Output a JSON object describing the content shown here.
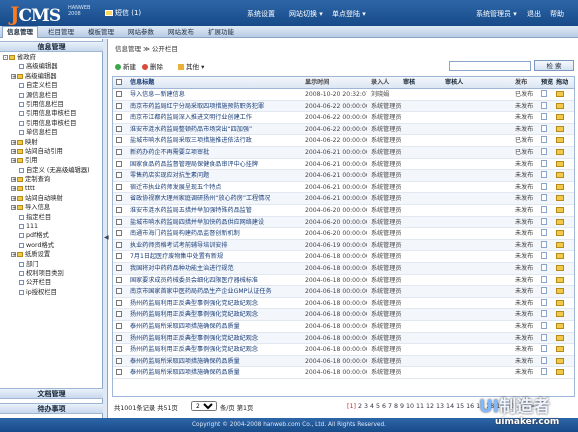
{
  "app": {
    "logo_j": "J",
    "logo_rest": "CMS",
    "logo_sub1": "HANWEB",
    "logo_sub2": "2008"
  },
  "header": {
    "messages": "短信 (1)",
    "links": [
      "系统设置",
      "网站切换 ▾",
      "单点登陆 ▾",
      "系统管理员 ▾",
      "退出",
      "帮助"
    ]
  },
  "nav": {
    "tabs": [
      "信息管理",
      "栏目管理",
      "模板管理",
      "网站参数",
      "网站发布",
      "扩展功能"
    ]
  },
  "sidebar": {
    "title": "信息管理",
    "tree": [
      {
        "label": "省政府",
        "d": 0,
        "x": "-",
        "t": "f"
      },
      {
        "label": "高级编辑器",
        "d": 1,
        "x": "",
        "t": "p"
      },
      {
        "label": "高级编辑器",
        "d": 1,
        "x": "+",
        "t": "f"
      },
      {
        "label": "自定义栏目",
        "d": 1,
        "x": "",
        "t": "p"
      },
      {
        "label": "源信息栏目",
        "d": 1,
        "x": "",
        "t": "p"
      },
      {
        "label": "引用信息栏目",
        "d": 1,
        "x": "",
        "t": "p"
      },
      {
        "label": "引用信息审核栏目",
        "d": 1,
        "x": "",
        "t": "p"
      },
      {
        "label": "引用信息审核栏目",
        "d": 1,
        "x": "",
        "t": "p"
      },
      {
        "label": "单信息栏目",
        "d": 1,
        "x": "",
        "t": "p"
      },
      {
        "label": "映射",
        "d": 1,
        "x": "+",
        "t": "f"
      },
      {
        "label": "站间自动引用",
        "d": 1,
        "x": "+",
        "t": "f"
      },
      {
        "label": "引用",
        "d": 1,
        "x": "+",
        "t": "f"
      },
      {
        "label": "自定义 (无高级编辑器)",
        "d": 1,
        "x": "",
        "t": "p"
      },
      {
        "label": "定制查询",
        "d": 1,
        "x": "+",
        "t": "f"
      },
      {
        "label": "tttt",
        "d": 1,
        "x": "+",
        "t": "f"
      },
      {
        "label": "站间自动映射",
        "d": 1,
        "x": "+",
        "t": "f"
      },
      {
        "label": "导入信息",
        "d": 1,
        "x": "+",
        "t": "f"
      },
      {
        "label": "指定栏目",
        "d": 1,
        "x": "",
        "t": "p"
      },
      {
        "label": "111",
        "d": 1,
        "x": "",
        "t": "p"
      },
      {
        "label": "pdf格式",
        "d": 1,
        "x": "",
        "t": "p"
      },
      {
        "label": "word格式",
        "d": 1,
        "x": "",
        "t": "p"
      },
      {
        "label": "纸质设置",
        "d": 1,
        "x": "+",
        "t": "f"
      },
      {
        "label": "部门",
        "d": 1,
        "x": "",
        "t": "p"
      },
      {
        "label": "权利项目类别",
        "d": 1,
        "x": "",
        "t": "p"
      },
      {
        "label": "公开栏目",
        "d": 1,
        "x": "",
        "t": "p"
      },
      {
        "label": "ip授权栏目",
        "d": 1,
        "x": "",
        "t": "p"
      }
    ],
    "section_docs": "文档管理",
    "section_tasks": "待办事项"
  },
  "main": {
    "breadcrumb": "信息管理 ≫ 公开栏目",
    "toolbar": {
      "add": "新建",
      "delete": "删除",
      "other": "其他 ▾",
      "search": "检 索"
    },
    "table": {
      "headers": [
        "信息标题",
        "显示时间",
        "录入人",
        "审核",
        "审核人",
        "发布",
        "预览",
        "拖动"
      ],
      "rows": [
        {
          "title": "导入信息—新建信息",
          "date": "2008-10-20 20:32:07",
          "user": "刘晓娟",
          "pub": "已发布"
        },
        {
          "title": "南京市药监局红宁分局采取四项措施预防职务犯罪",
          "date": "2004-06-22 00:00:00",
          "user": "系统管理员",
          "pub": "未发布"
        },
        {
          "title": "南京市江都药监局深入推进文明行业创建工作",
          "date": "2004-06-22 00:00:00",
          "user": "系统管理员",
          "pub": "未发布"
        },
        {
          "title": "淮安市涟水药监局整顿药品市场突出“四加强”",
          "date": "2004-06-22 00:00:00",
          "user": "系统管理员",
          "pub": "未发布"
        },
        {
          "title": "盐城市响水药监局采取三项措施推进依法行政",
          "date": "2004-06-22 00:00:00",
          "user": "系统管理员",
          "pub": "已发布"
        },
        {
          "title": "新药办药企不再需要立项审批",
          "date": "2004-06-21 00:00:00",
          "user": "系统管理员",
          "pub": "已发布"
        },
        {
          "title": "国家食品药品监督管理局保健食品审评中心挂牌",
          "date": "2004-06-21 00:00:00",
          "user": "系统管理员",
          "pub": "未发布"
        },
        {
          "title": "零售药店实现应对抗生素问题",
          "date": "2004-06-21 00:00:00",
          "user": "系统管理员",
          "pub": "未发布"
        },
        {
          "title": "宿迁市执业药师发展呈现五个特点",
          "date": "2004-06-21 00:00:00",
          "user": "系统管理员",
          "pub": "未发布"
        },
        {
          "title": "省政协视察大理州家庭调研扬州“放心药房”工程情况",
          "date": "2004-06-21 00:00:00",
          "user": "系统管理员",
          "pub": "未发布"
        },
        {
          "title": "淮安市涟水药监局五措并举加强特殊药品监管",
          "date": "2004-06-20 00:00:00",
          "user": "系统管理员",
          "pub": "未发布"
        },
        {
          "title": "盐城市响水药监局四措并举加快药品供应网络建设",
          "date": "2004-06-20 00:00:00",
          "user": "系统管理员",
          "pub": "未发布"
        },
        {
          "title": "南通市海门药监局构建药品监督创新机制",
          "date": "2004-06-20 00:00:00",
          "user": "系统管理员",
          "pub": "未发布"
        },
        {
          "title": "执业药师资格考试考前辅导培训安排",
          "date": "2004-06-19 00:00:00",
          "user": "系统管理员",
          "pub": "未发布"
        },
        {
          "title": "7月1日起医疗废物集中处置有新规",
          "date": "2004-06-18 00:00:00",
          "user": "系统管理员",
          "pub": "未发布"
        },
        {
          "title": "我国将对中药药品种功能主治进行规范",
          "date": "2004-06-18 00:00:00",
          "user": "系统管理员",
          "pub": "未发布"
        },
        {
          "title": "国家要求成员药械委员会细化四限医疗器械标准",
          "date": "2004-06-18 00:00:00",
          "user": "系统管理员",
          "pub": "未发布"
        },
        {
          "title": "南京市国家首家中医药局药品生产企业GMP认证任务",
          "date": "2004-06-18 00:00:00",
          "user": "系统管理员",
          "pub": "未发布"
        },
        {
          "title": "扬州药监局利用正反典型事例强化党纪政纪观念",
          "date": "2004-06-18 00:00:00",
          "user": "系统管理员",
          "pub": "未发布"
        },
        {
          "title": "扬州药监局利用正反典型事例强化党纪政纪观念",
          "date": "2004-06-18 00:00:00",
          "user": "系统管理员",
          "pub": "未发布"
        },
        {
          "title": "泰州药监局所采取四项措施确保药品质量",
          "date": "2004-06-18 00:00:00",
          "user": "系统管理员",
          "pub": "未发布"
        },
        {
          "title": "扬州药监局利用正反典型事例强化党纪政纪观念",
          "date": "2004-06-18 00:00:00",
          "user": "系统管理员",
          "pub": "未发布"
        },
        {
          "title": "扬州药监局利用正反典型事例强化党纪政纪观念",
          "date": "2004-06-18 00:00:00",
          "user": "系统管理员",
          "pub": "未发布"
        },
        {
          "title": "泰州药监局所采取四项措施确保药品质量",
          "date": "2004-06-18 00:00:00",
          "user": "系统管理员",
          "pub": "未发布"
        },
        {
          "title": "泰州药监局所采取四项措施确保药品质量",
          "date": "2004-06-18 00:00:00",
          "user": "系统管理员",
          "pub": "未发布"
        }
      ]
    },
    "pager": {
      "total": "共1001条记录  共51页",
      "page_size": "20",
      "per_page_text": "条/页  第1页",
      "current_page": "[1]",
      "pages": "2 3 4 5 6 7 8 9 10 11 12 13 14 15 16 17 18 19 20 ...  >>"
    }
  },
  "footer": {
    "text": "Copyright © 2004-2008 hanweb.com Co., Ltd. All Rights Reserved."
  },
  "watermark": {
    "ui": "UI",
    "line1": "制造者",
    "line2": "uimaker.com"
  }
}
